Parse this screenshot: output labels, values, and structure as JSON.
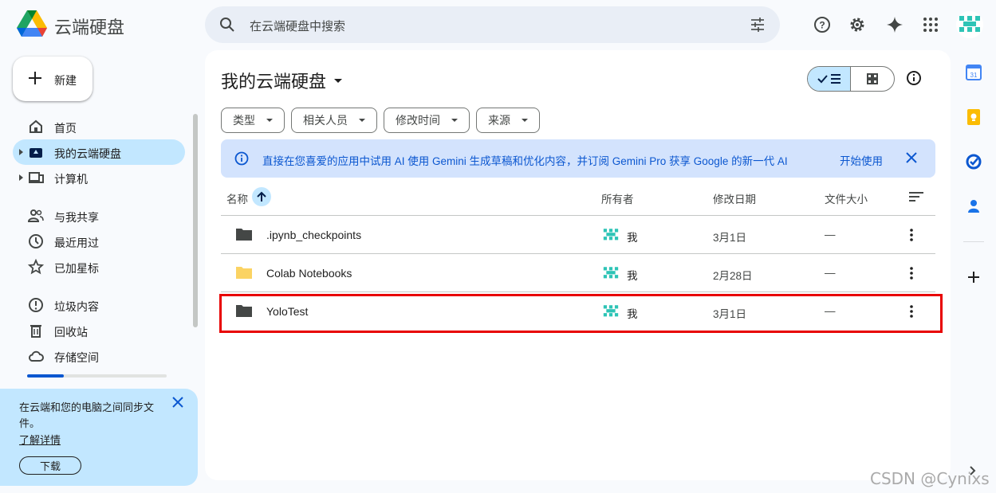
{
  "app": {
    "name": "云端硬盘",
    "logo": "drive-logo"
  },
  "search": {
    "placeholder": "在云端硬盘中搜索"
  },
  "header_icons": [
    "help-icon",
    "settings-icon",
    "gemini-sparkle-icon",
    "apps-grid-icon",
    "account-avatar"
  ],
  "sidebar": {
    "new_label": "新建",
    "items": [
      {
        "label": "首页",
        "icon": "home-icon"
      },
      {
        "label": "我的云端硬盘",
        "icon": "my-drive-icon",
        "active": true
      },
      {
        "label": "计算机",
        "icon": "computer-icon"
      },
      {
        "label": "与我共享",
        "icon": "shared-icon"
      },
      {
        "label": "最近用过",
        "icon": "recent-icon"
      },
      {
        "label": "已加星标",
        "icon": "star-icon"
      },
      {
        "label": "垃圾内容",
        "icon": "spam-icon"
      },
      {
        "label": "回收站",
        "icon": "trash-icon"
      },
      {
        "label": "存储空间",
        "icon": "cloud-icon"
      }
    ],
    "storage_used_fraction": 0.26,
    "sync_card": {
      "text": "在云端和您的电脑之间同步文件。",
      "link": "了解详情",
      "button": "下载"
    }
  },
  "main": {
    "title": "我的云端硬盘",
    "filters": [
      "类型",
      "相关人员",
      "修改时间",
      "来源"
    ],
    "banner": {
      "text": "直接在您喜爱的应用中试用 AI 使用 Gemini 生成草稿和优化内容，并订阅 Gemini Pro 获享 Google 的新一代 AI",
      "action": "开始使用"
    },
    "columns": {
      "name": "名称",
      "owner": "所有者",
      "modified": "修改日期",
      "size": "文件大小"
    },
    "rows": [
      {
        "name": ".ipynb_checkpoints",
        "owner": "我",
        "modified": "3月1日",
        "size": "—",
        "color": "#444746"
      },
      {
        "name": "Colab Notebooks",
        "owner": "我",
        "modified": "2月28日",
        "size": "—",
        "color": "#fbd363"
      },
      {
        "name": "YoloTest",
        "owner": "我",
        "modified": "3月1日",
        "size": "—",
        "color": "#444746",
        "highlighted": true
      }
    ]
  },
  "right_rail": [
    "calendar-icon",
    "keep-icon",
    "tasks-icon",
    "contacts-icon",
    "add-icon"
  ],
  "watermark": "CSDN @Cynixs",
  "colors": {
    "accent": "#0b57d0",
    "active_bg": "#c2e7ff",
    "highlight": "#e80000"
  }
}
